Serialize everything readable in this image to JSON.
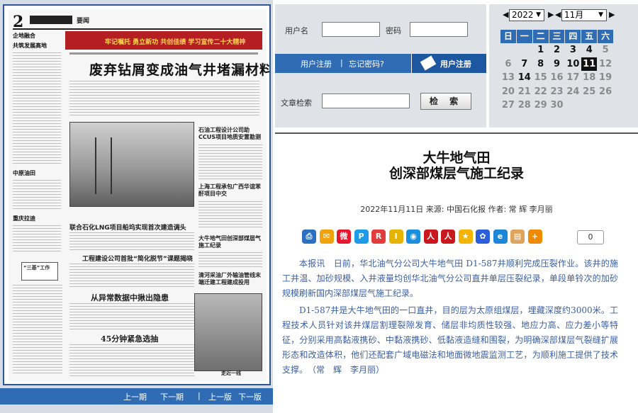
{
  "newspaper": {
    "page_number": "2",
    "section": "要闻",
    "banner": "牢记嘱托 勇立新功 共创佳绩 学习宣传二十大精神",
    "headline": "废弃钻屑变成油气井堵漏材料",
    "left_col": [
      "企地融合",
      "共筑发展高地",
      "中原油田",
      "重庆拉迪",
      "三基工作"
    ],
    "sub_headlines": [
      "石油工程设计公司助CCUS项目地质安置勘测",
      "上海工程承包广西华谊苯酐项目中交",
      "联合石化LNG项目船坞实现首次建造调头",
      "工程建设公司首批“简化脱节”课题揭晓",
      "从异常数据中揪出隐患",
      "45分钟紧急选抽",
      "大牛地气田创深部煤层气施工纪录",
      "清河采油厂外输油管线末端迁建工程建成投用"
    ],
    "stamp": "“三基”工作",
    "footer_link": "走近一线"
  },
  "page_nav": {
    "prev_issue": "上一期",
    "next_issue": "下一期",
    "prev_page": "上一版",
    "next_page": "下一版",
    "sep": "|"
  },
  "login": {
    "username_label": "用户名",
    "password_label": "密码",
    "username_value": "",
    "password_value": "",
    "search_label": "文章检索",
    "search_value": "",
    "search_button": "检 索",
    "user_login_link": "用户注册",
    "forgot_link": "忘记密码?",
    "link_sep": "|",
    "register_button": "用户注册"
  },
  "calendar": {
    "prev": "◀",
    "next": "▶",
    "year": "2022",
    "month": "11月",
    "weekdays": [
      "日",
      "一",
      "二",
      "三",
      "四",
      "五",
      "六"
    ],
    "weeks": [
      [
        "",
        "",
        "1",
        "2",
        "3",
        "4",
        "5"
      ],
      [
        "6",
        "7",
        "8",
        "9",
        "10",
        "11",
        "12"
      ],
      [
        "13",
        "14",
        "15",
        "16",
        "17",
        "18",
        "19"
      ],
      [
        "20",
        "21",
        "22",
        "23",
        "24",
        "25",
        "26"
      ],
      [
        "27",
        "28",
        "29",
        "30",
        "",
        "",
        ""
      ]
    ],
    "active_days": [
      "1",
      "2",
      "3",
      "4",
      "7",
      "8",
      "9",
      "10",
      "11",
      "14"
    ],
    "current_day": "11"
  },
  "article": {
    "title_line1": "大牛地气田",
    "title_line2": "创深部煤层气施工纪录",
    "meta": "2022年11月11日 来源: 中国石化报 作者: 常 辉 李月丽",
    "share_count": "0",
    "share_icons": [
      {
        "name": "print",
        "color": "#2d6fc0",
        "glyph": "⎙"
      },
      {
        "name": "email",
        "color": "#f0a30a",
        "glyph": "✉"
      },
      {
        "name": "weibo",
        "color": "#e6162d",
        "glyph": "微"
      },
      {
        "name": "qzone",
        "color": "#1e9be8",
        "glyph": "P"
      },
      {
        "name": "renren",
        "color": "#e23c3c",
        "glyph": "R"
      },
      {
        "name": "tieba",
        "color": "#e8b300",
        "glyph": "I"
      },
      {
        "name": "kaixin",
        "color": "#1a8fe0",
        "glyph": "◉"
      },
      {
        "name": "people",
        "color": "#c9181e",
        "glyph": "人"
      },
      {
        "name": "people2",
        "color": "#c9181e",
        "glyph": "人"
      },
      {
        "name": "favorite",
        "color": "#f5b400",
        "glyph": "★"
      },
      {
        "name": "baidu",
        "color": "#2b5fd9",
        "glyph": "✿"
      },
      {
        "name": "ie",
        "color": "#1c86d8",
        "glyph": "e"
      },
      {
        "name": "copy",
        "color": "#e0a35c",
        "glyph": "▤"
      },
      {
        "name": "more",
        "color": "#f08a00",
        "glyph": "+"
      }
    ],
    "paragraphs": [
      "本报讯　日前，华北油气分公司大牛地气田 D1-587井顺利完成压裂作业。该井的施工井温、加砂规模、入井液量均创华北油气分公司直井单层压裂纪录，单段单铃次的加砂规模刷新国内深部煤层气施工纪录。",
      "D1-587井是大牛地气田的一口直井，目的层为太原组煤层，埋藏深度约3000米。工程技术人员针对该井煤层割理裂隙发育、储层非均质性较强、地应力高、应力差小等特征，分别采用高黏液携砂、中黏液携砂、低黏液造缝和围裂，为明确深部煤层气裂缝扩展形态和改造体积，他们还配套广域电磁法和地面微地震监测工艺，为顺利施工提供了技术支撑。　（常　辉　李月丽）"
    ]
  }
}
